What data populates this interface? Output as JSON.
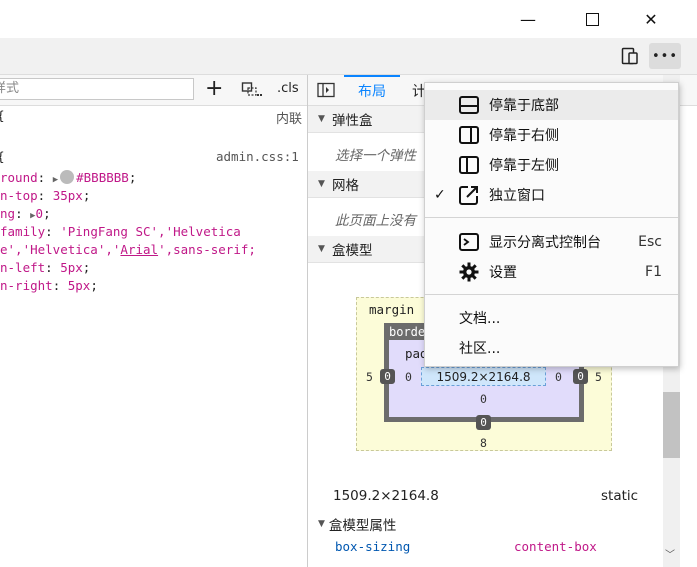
{
  "titlebar": {
    "minimize": "—",
    "maximize": "☐",
    "close": "✕"
  },
  "toolbar": {
    "overflow_icon": "•••"
  },
  "rules": {
    "filter_placeholder": "样式",
    "add_icon": "+",
    "cls_label": ".cls",
    "inline_label": "内联",
    "brace_open": "{",
    "source_file": "admin.css:1",
    "lines": [
      {
        "prop": "round",
        "colon": ":",
        "swatch": "#BBBBBB",
        "value": "#BBBBBB",
        "end": ";"
      },
      {
        "prop": "n-top",
        "colon": ":",
        "value": "35px",
        "end": ";"
      },
      {
        "prop": "ng",
        "colon": ":",
        "arrow": "▶",
        "value": "0",
        "end": ";"
      },
      {
        "prop": "family",
        "colon": ":",
        "value": "'PingFang SC','Helvetica"
      },
      {
        "prop": "e','Helvetica','Arial',sans-serif",
        "colon": "",
        "value": "",
        "end": ";"
      },
      {
        "prop": "n-left",
        "colon": ":",
        "value": "5px",
        "end": ";"
      },
      {
        "prop": "n-right",
        "colon": ":",
        "value": "5px",
        "end": ";"
      }
    ],
    "family_line2_a": "e','Helvetica','",
    "family_line2_arial": "Arial",
    "family_line2_b": "',sans-serif;"
  },
  "layout_panel": {
    "tab_layout": "布局",
    "tab_next": "计",
    "flexbox_header": "弹性盒",
    "flexbox_hint": "选择一个弹性",
    "grid_header": "网格",
    "grid_hint": "此页面上没有",
    "boxmodel_header": "盒模型",
    "box_model": {
      "margin_label": "margin",
      "border_label": "border",
      "padding_label": "pad",
      "content_size": "1509.2×2164.8",
      "margin_left": "5",
      "margin_right": "5",
      "margin_bottom": "8",
      "border_left": "0",
      "border_right": "0",
      "border_bottom": "0",
      "padding_left": "0",
      "padding_right": "0",
      "padding_bottom": "0"
    },
    "dimensions": "1509.2×2164.8",
    "position": "static",
    "props_header": "盒模型属性",
    "prop_name": "box-sizing",
    "prop_value": "content-box"
  },
  "menu": {
    "items": [
      {
        "label": "停靠于底部",
        "icon": "dock-bottom-icon",
        "shortcut": "",
        "checked": false
      },
      {
        "label": "停靠于右侧",
        "icon": "dock-right-icon",
        "shortcut": "",
        "checked": false
      },
      {
        "label": "停靠于左侧",
        "icon": "dock-left-icon",
        "shortcut": "",
        "checked": false
      },
      {
        "label": "独立窗口",
        "icon": "separate-window-icon",
        "shortcut": "",
        "checked": true
      },
      {
        "label": "显示分离式控制台",
        "icon": "console-icon",
        "shortcut": "Esc",
        "checked": false
      },
      {
        "label": "设置",
        "icon": "gear-icon",
        "shortcut": "F1",
        "checked": false
      },
      {
        "label": "文档...",
        "icon": "",
        "shortcut": "",
        "checked": false
      },
      {
        "label": "社区...",
        "icon": "",
        "shortcut": "",
        "checked": false
      }
    ],
    "check_glyph": "✓"
  },
  "colors": {
    "accent": "#0a84ff",
    "menu_highlight": "#ebebeb",
    "swatch": "#BBBBBB"
  }
}
